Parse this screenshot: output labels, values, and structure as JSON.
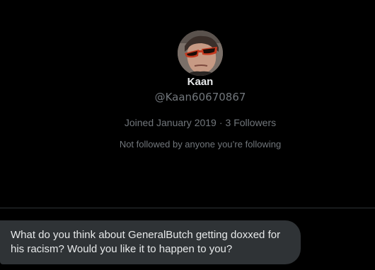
{
  "profile": {
    "display_name": "Kaan",
    "handle": "@Kaan60670867",
    "joined": "Joined January 2019",
    "separator": "·",
    "followers": "3 Followers",
    "followed_note": "Not followed by anyone you’re following",
    "avatar_icon": "profile-photo"
  },
  "conversation": {
    "messages": [
      {
        "direction": "sent-incoming",
        "text": "What do you think about GeneralButch getting doxxed for his racism? Would you like it to happen to you?"
      }
    ]
  },
  "colors": {
    "background": "#000000",
    "primary_text": "#e7e9ea",
    "secondary_text": "#71767b",
    "bubble_bg": "#2f3336",
    "divider": "#2f3336"
  }
}
